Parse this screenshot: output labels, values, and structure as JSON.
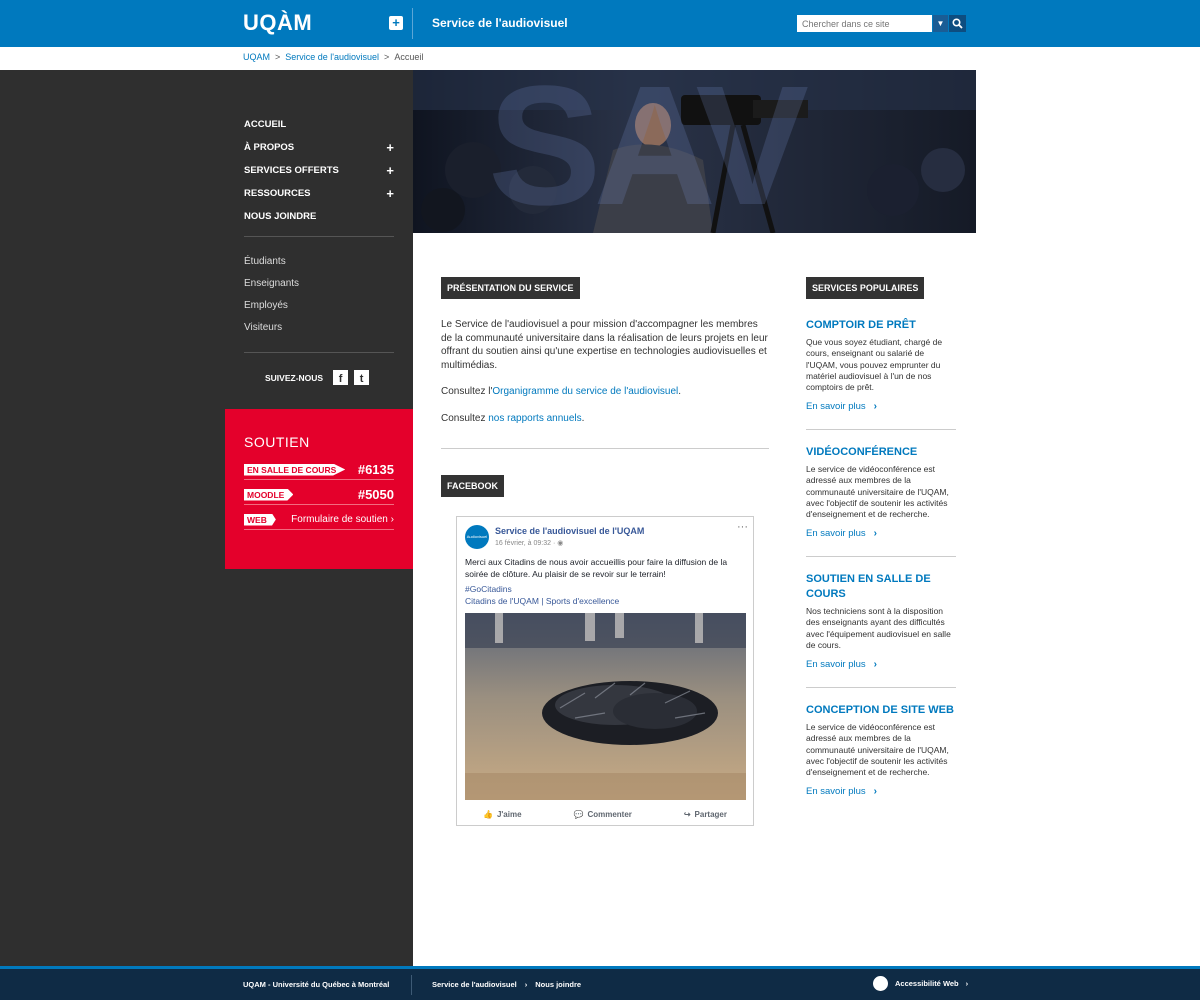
{
  "header": {
    "logo": "UQÀM",
    "plus_label": "+",
    "site_title": "Service de l'audiovisuel",
    "search_placeholder": "Chercher dans ce site",
    "dropdown_symbol": "▼"
  },
  "breadcrumb": {
    "items": [
      "UQAM",
      "Service de l'audiovisuel",
      "Accueil"
    ],
    "separator": ">"
  },
  "sidebar": {
    "nav": [
      {
        "label": "ACCUEIL",
        "expandable": false
      },
      {
        "label": "À PROPOS",
        "expandable": true
      },
      {
        "label": "SERVICES OFFERTS",
        "expandable": true
      },
      {
        "label": "RESSOURCES",
        "expandable": true
      },
      {
        "label": "NOUS JOINDRE",
        "expandable": false
      }
    ],
    "expand_symbol": "+",
    "audiences": [
      "Étudiants",
      "Enseignants",
      "Employés",
      "Visiteurs"
    ],
    "follow_label": "SUIVEZ-NOUS",
    "social": [
      "facebook-icon",
      "twitter-icon"
    ],
    "social_glyphs": [
      "f",
      "t"
    ]
  },
  "soutien": {
    "title": "SOUTIEN",
    "rows": [
      {
        "tag": "EN SALLE DE COURS",
        "value": "#6135"
      },
      {
        "tag": "MOODLE",
        "value": "#5050"
      },
      {
        "tag": "WEB",
        "value": "Formulaire de soutien"
      }
    ],
    "chevron": "›"
  },
  "hero": {
    "overlay_letters": "SAV"
  },
  "main": {
    "presentation_title": "PRÉSENTATION DU SERVICE",
    "intro": "Le Service de l'audiovisuel a pour mission d'accompagner les membres de la communauté universitaire dans la réalisation de leurs projets en leur offrant du soutien ainsi qu'une expertise en technologies audiovisuelles et multimédias.",
    "consult_1_prefix": "Consultez l'",
    "consult_1_link": "Organigramme du service de l'audiovisuel",
    "consult_1_suffix": ".",
    "consult_2_prefix": "Consultez ",
    "consult_2_link": "nos rapports annuels",
    "consult_2_suffix": ".",
    "facebook_title": "FACEBOOK"
  },
  "facebook_post": {
    "avatar_text": "Audiovisuel UQAM",
    "page_name": "Service de l'audiovisuel de l'UQAM",
    "date": "16 février, à 09:32 · ",
    "more": "···",
    "text": "Merci aux Citadins de nous avoir accueillis pour faire la diffusion de la soirée de clôture. Au plaisir de se revoir sur le terrain!",
    "hashtag": "#GoCitadins",
    "mention": "Citadins de l'UQAM | Sports d'excellence",
    "actions": [
      "J'aime",
      "Commenter",
      "Partager"
    ]
  },
  "popular": {
    "title": "SERVICES POPULAIRES",
    "link_label": "En savoir plus",
    "chevron": "›",
    "items": [
      {
        "title": "COMPTOIR DE PRÊT",
        "desc": "Que vous soyez étudiant, chargé de cours, enseignant ou salarié de l'UQAM, vous pouvez emprunter du matériel audiovisuel à l'un de nos comptoirs de prêt."
      },
      {
        "title": "VIDÉOCONFÉRENCE",
        "desc": "Le service de vidéoconférence  est adressé aux membres de la communauté universitaire de l'UQAM, avec l'objectif de soutenir les activités d'enseignement et de recherche."
      },
      {
        "title": "SOUTIEN EN SALLE DE COURS",
        "desc": "Nos techniciens sont à la disposition des enseignants ayant des difficultés avec l'équipement audiovisuel en salle de cours."
      },
      {
        "title": "CONCEPTION DE SITE WEB",
        "desc": "Le service de vidéoconférence  est adressé aux membres de la communauté universitaire de l'UQAM, avec l'objectif de soutenir les activités d'enseignement et de recherche."
      }
    ]
  },
  "footer": {
    "university": "UQAM - Université du Québec à Montréal",
    "link_1": "Service de l'audiovisuel",
    "link_2": "Nous joindre",
    "accessibility": "Accessibilité Web",
    "chevron": "›"
  },
  "colors": {
    "brand_blue": "#0079be",
    "sidebar_dark": "#2f2f2f",
    "soutien_red": "#e4002b",
    "footer_navy": "#0f2b45"
  }
}
